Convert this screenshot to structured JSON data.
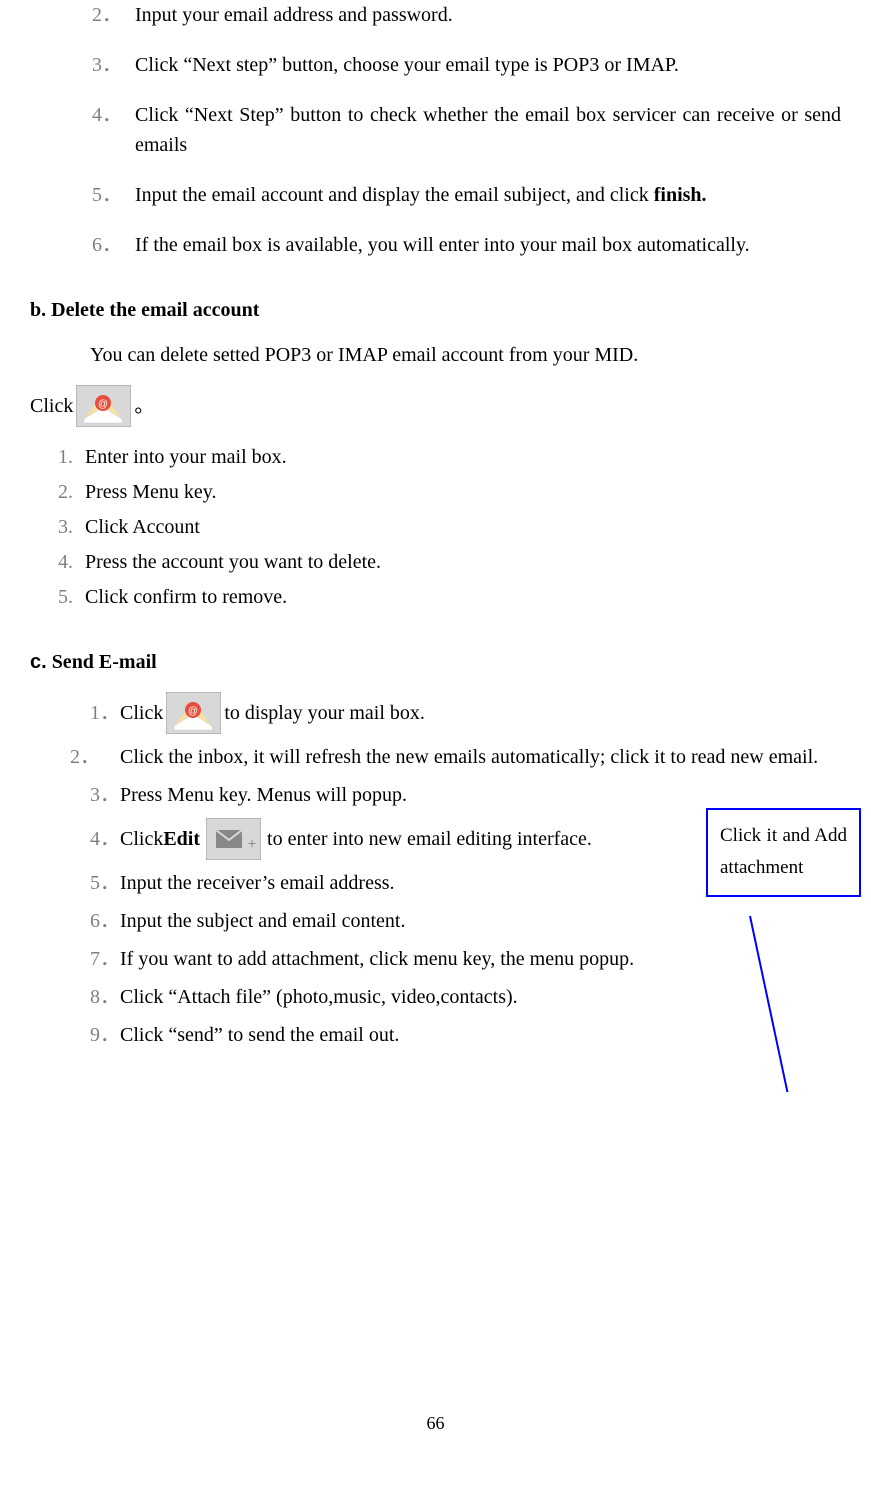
{
  "sectionA": {
    "items": [
      {
        "num": "2．",
        "text": "Input your email address and password."
      },
      {
        "num": "3．",
        "text": "Click “Next step” button, choose your email type is POP3 or IMAP."
      },
      {
        "num": "4．",
        "text": "Click “Next Step” button to check whether the email box servicer can receive or send emails"
      },
      {
        "num": "5．",
        "text_pre": "Input the email account and display the email subiject, and click ",
        "bold": "finish."
      },
      {
        "num": "6．",
        "text": "If the email box is available, you will enter into your mail box automatically."
      }
    ]
  },
  "sectionB": {
    "heading": "b. Delete the email account",
    "intro": "You can delete setted POP3 or IMAP email account from your MID.",
    "click_label": "Click",
    "period": "。",
    "items": [
      {
        "num": "1.",
        "text": "Enter into your mail box."
      },
      {
        "num": "2.",
        "text": "Press Menu key."
      },
      {
        "num": "3.",
        "text": "Click Account"
      },
      {
        "num": "4.",
        "text": "Press the account you want to delete."
      },
      {
        "num": "5.",
        "text": "Click confirm to remove."
      }
    ]
  },
  "sectionC": {
    "heading_prefix": "c.",
    "heading_main": "  Send E-mail",
    "items": [
      {
        "num": "1．",
        "pre": "Click ",
        "post": " to display your mail box."
      },
      {
        "num": "2．",
        "text": " Click the inbox, it will refresh the new emails automatically; click it to read new email."
      },
      {
        "num": "3．",
        "text": "Press Menu key. Menus will popup."
      },
      {
        "num": "4．",
        "pre": "Click ",
        "bold": "Edit",
        "post": "  to enter into new email editing interface."
      },
      {
        "num": "5．",
        "text": "Input the receiver’s email address."
      },
      {
        "num": "6．",
        "text": "Input the subject and email content."
      },
      {
        "num": "7．",
        "text": "If you want to add attachment, click menu key, the menu popup."
      },
      {
        "num": "8．",
        "text": "Click “Attach file” (photo,music, video,contacts)."
      },
      {
        "num": "9．",
        "text": "Click “send” to send the email out."
      }
    ]
  },
  "callout": {
    "text": "Click it and Add attachment"
  },
  "page_number": "66"
}
